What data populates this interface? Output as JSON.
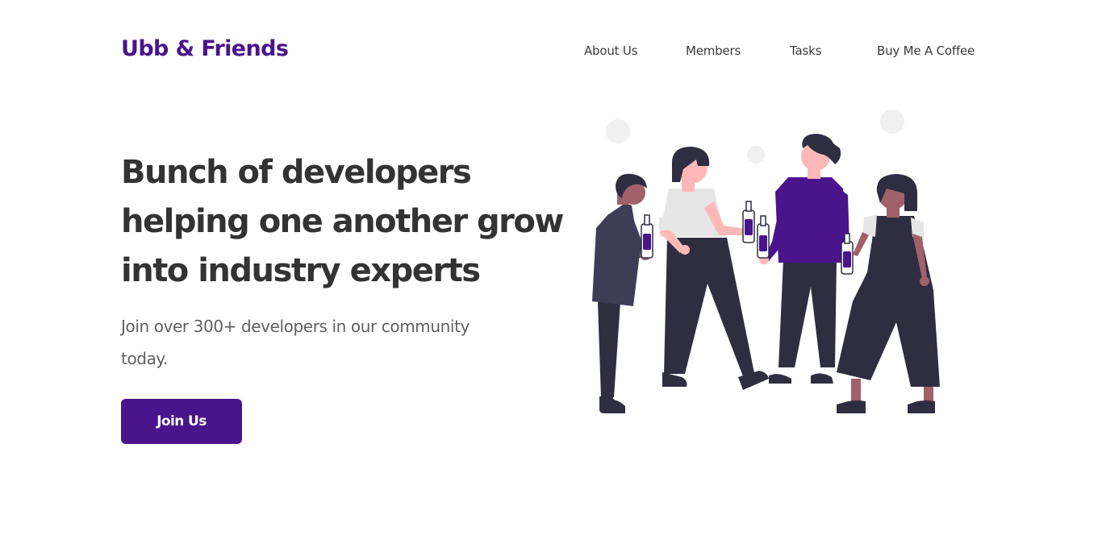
{
  "header": {
    "brand": "Ubb & Friends",
    "nav": [
      {
        "label": "About Us"
      },
      {
        "label": "Members"
      },
      {
        "label": "Tasks"
      },
      {
        "label": "Buy Me A Coffee"
      }
    ]
  },
  "hero": {
    "title_lines": [
      "Bunch of developers",
      "helping one another grow",
      "into industry experts"
    ],
    "subtitle_lines": [
      "Join over 300+ developers in our community",
      "today."
    ],
    "cta_label": "Join Us"
  },
  "colors": {
    "brand": "#4a148c",
    "heading": "#333333",
    "body_text": "#5f5f5f",
    "dark_clothing": "#2f2e41",
    "skin_light": "#ffb8b8",
    "skin_dark": "#a0616a",
    "bubble": "#f0f0f0"
  },
  "illustration": {
    "icon": "people-toasting-illustration"
  }
}
